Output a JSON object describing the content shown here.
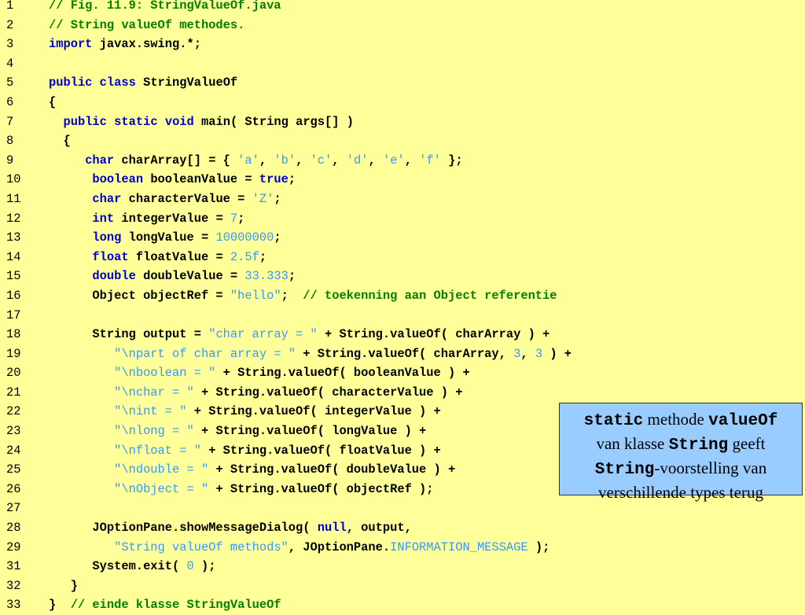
{
  "code_lines": [
    {
      "n": "1",
      "indent": "",
      "tokens": [
        {
          "t": "// Fig. 11.9: StringValueOf.java",
          "c": "cm"
        }
      ]
    },
    {
      "n": "2",
      "indent": "",
      "tokens": [
        {
          "t": "// String valueOf methodes.",
          "c": "cm"
        }
      ]
    },
    {
      "n": "3",
      "indent": "",
      "tokens": [
        {
          "t": "import",
          "c": "kw"
        },
        {
          "t": " javax.swing.*;",
          "c": "tx"
        }
      ]
    },
    {
      "n": "4",
      "indent": "",
      "tokens": []
    },
    {
      "n": "5",
      "indent": "",
      "tokens": [
        {
          "t": "public",
          "c": "kw"
        },
        {
          "t": " ",
          "c": "tx"
        },
        {
          "t": "class",
          "c": "kw"
        },
        {
          "t": " StringValueOf",
          "c": "tx"
        }
      ]
    },
    {
      "n": "6",
      "indent": "",
      "tokens": [
        {
          "t": "{",
          "c": "tx"
        }
      ]
    },
    {
      "n": "7",
      "indent": "  ",
      "tokens": [
        {
          "t": "public",
          "c": "kw"
        },
        {
          "t": " ",
          "c": "tx"
        },
        {
          "t": "static",
          "c": "kw"
        },
        {
          "t": " ",
          "c": "tx"
        },
        {
          "t": "void",
          "c": "kw"
        },
        {
          "t": " main( String args[] )",
          "c": "tx"
        }
      ]
    },
    {
      "n": "8",
      "indent": "  ",
      "tokens": [
        {
          "t": "{",
          "c": "tx"
        }
      ]
    },
    {
      "n": "9",
      "indent": "     ",
      "tokens": [
        {
          "t": "char",
          "c": "kw"
        },
        {
          "t": " charArray[] = { ",
          "c": "tx"
        },
        {
          "t": "'a'",
          "c": "lit"
        },
        {
          "t": ", ",
          "c": "tx"
        },
        {
          "t": "'b'",
          "c": "lit"
        },
        {
          "t": ", ",
          "c": "tx"
        },
        {
          "t": "'c'",
          "c": "lit"
        },
        {
          "t": ", ",
          "c": "tx"
        },
        {
          "t": "'d'",
          "c": "lit"
        },
        {
          "t": ", ",
          "c": "tx"
        },
        {
          "t": "'e'",
          "c": "lit"
        },
        {
          "t": ", ",
          "c": "tx"
        },
        {
          "t": "'f'",
          "c": "lit"
        },
        {
          "t": " };",
          "c": "tx"
        }
      ]
    },
    {
      "n": "10",
      "indent": "      ",
      "tokens": [
        {
          "t": "boolean",
          "c": "kw"
        },
        {
          "t": " booleanValue = ",
          "c": "tx"
        },
        {
          "t": "true",
          "c": "kw"
        },
        {
          "t": ";",
          "c": "tx"
        }
      ]
    },
    {
      "n": "11",
      "indent": "      ",
      "tokens": [
        {
          "t": "char",
          "c": "kw"
        },
        {
          "t": " characterValue = ",
          "c": "tx"
        },
        {
          "t": "'Z'",
          "c": "lit"
        },
        {
          "t": ";",
          "c": "tx"
        }
      ]
    },
    {
      "n": "12",
      "indent": "      ",
      "tokens": [
        {
          "t": "int",
          "c": "kw"
        },
        {
          "t": " integerValue = ",
          "c": "tx"
        },
        {
          "t": "7",
          "c": "lit"
        },
        {
          "t": ";",
          "c": "tx"
        }
      ]
    },
    {
      "n": "13",
      "indent": "      ",
      "tokens": [
        {
          "t": "long",
          "c": "kw"
        },
        {
          "t": " longValue = ",
          "c": "tx"
        },
        {
          "t": "10000000",
          "c": "lit"
        },
        {
          "t": ";",
          "c": "tx"
        }
      ]
    },
    {
      "n": "14",
      "indent": "      ",
      "tokens": [
        {
          "t": "float",
          "c": "kw"
        },
        {
          "t": " floatValue = ",
          "c": "tx"
        },
        {
          "t": "2.5f",
          "c": "lit"
        },
        {
          "t": ";",
          "c": "tx"
        }
      ]
    },
    {
      "n": "15",
      "indent": "      ",
      "tokens": [
        {
          "t": "double",
          "c": "kw"
        },
        {
          "t": " doubleValue = ",
          "c": "tx"
        },
        {
          "t": "33.333",
          "c": "lit"
        },
        {
          "t": ";",
          "c": "tx"
        }
      ]
    },
    {
      "n": "16",
      "indent": "      ",
      "tokens": [
        {
          "t": "Object objectRef = ",
          "c": "tx"
        },
        {
          "t": "\"hello\"",
          "c": "lit"
        },
        {
          "t": ";  ",
          "c": "tx"
        },
        {
          "t": "// toekenning aan Object referentie",
          "c": "cm"
        }
      ]
    },
    {
      "n": "17",
      "indent": "",
      "tokens": []
    },
    {
      "n": "18",
      "indent": "      ",
      "tokens": [
        {
          "t": "String output = ",
          "c": "tx"
        },
        {
          "t": "\"char array = \"",
          "c": "lit"
        },
        {
          "t": " + String.valueOf( charArray ) +",
          "c": "tx"
        }
      ]
    },
    {
      "n": "19",
      "indent": "         ",
      "tokens": [
        {
          "t": "\"\\npart of char array = \"",
          "c": "lit"
        },
        {
          "t": " + String.valueOf( charArray, ",
          "c": "tx"
        },
        {
          "t": "3",
          "c": "lit"
        },
        {
          "t": ", ",
          "c": "tx"
        },
        {
          "t": "3",
          "c": "lit"
        },
        {
          "t": " ) +",
          "c": "tx"
        }
      ]
    },
    {
      "n": "20",
      "indent": "         ",
      "tokens": [
        {
          "t": "\"\\nboolean = \"",
          "c": "lit"
        },
        {
          "t": " + String.valueOf( booleanValue ) +",
          "c": "tx"
        }
      ]
    },
    {
      "n": "21",
      "indent": "         ",
      "tokens": [
        {
          "t": "\"\\nchar = \"",
          "c": "lit"
        },
        {
          "t": " + String.valueOf( characterValue ) +",
          "c": "tx"
        }
      ]
    },
    {
      "n": "22",
      "indent": "         ",
      "tokens": [
        {
          "t": "\"\\nint = \"",
          "c": "lit"
        },
        {
          "t": " + String.valueOf( integerValue ) +",
          "c": "tx"
        }
      ]
    },
    {
      "n": "23",
      "indent": "         ",
      "tokens": [
        {
          "t": "\"\\nlong = \"",
          "c": "lit"
        },
        {
          "t": " + String.valueOf( longValue ) +",
          "c": "tx"
        }
      ]
    },
    {
      "n": "24",
      "indent": "         ",
      "tokens": [
        {
          "t": "\"\\nfloat = \"",
          "c": "lit"
        },
        {
          "t": " + String.valueOf( floatValue ) +",
          "c": "tx"
        }
      ]
    },
    {
      "n": "25",
      "indent": "         ",
      "tokens": [
        {
          "t": "\"\\ndouble = \"",
          "c": "lit"
        },
        {
          "t": " + String.valueOf( doubleValue ) +",
          "c": "tx"
        }
      ]
    },
    {
      "n": "26",
      "indent": "         ",
      "tokens": [
        {
          "t": "\"\\nObject = \"",
          "c": "lit"
        },
        {
          "t": " + String.valueOf( objectRef );",
          "c": "tx"
        }
      ]
    },
    {
      "n": "27",
      "indent": "",
      "tokens": []
    },
    {
      "n": "28",
      "indent": "      ",
      "tokens": [
        {
          "t": "JOptionPane.showMessageDialog( ",
          "c": "tx"
        },
        {
          "t": "null",
          "c": "kw"
        },
        {
          "t": ", output,",
          "c": "tx"
        }
      ]
    },
    {
      "n": "29",
      "indent": "         ",
      "tokens": [
        {
          "t": "\"String valueOf methods\"",
          "c": "lit"
        },
        {
          "t": ", JOptionPane.",
          "c": "tx"
        },
        {
          "t": "INFORMATION_MESSAGE",
          "c": "lit"
        },
        {
          "t": " );",
          "c": "tx"
        }
      ]
    },
    {
      "n": "31",
      "indent": "      ",
      "tokens": [
        {
          "t": "System.exit( ",
          "c": "tx"
        },
        {
          "t": "0",
          "c": "lit"
        },
        {
          "t": " );",
          "c": "tx"
        }
      ]
    },
    {
      "n": "32",
      "indent": "   ",
      "tokens": [
        {
          "t": "}",
          "c": "tx"
        }
      ]
    },
    {
      "n": "33",
      "indent": "",
      "tokens": [
        {
          "t": "}  ",
          "c": "tx"
        },
        {
          "t": "// einde klasse StringValueOf",
          "c": "cm"
        }
      ]
    }
  ],
  "callout": {
    "w1": "static",
    "w2": " methode ",
    "w3": "valueOf",
    "w4": "van klasse ",
    "w5": "String",
    "w6": " geeft",
    "w7": "String",
    "w8": "-voorstelling van",
    "w9": "verschillende types terug"
  },
  "colors": {
    "background": "#ffff99",
    "keyword": "#0000cc",
    "comment": "#008000",
    "literal": "#3399ff",
    "callout_bg": "#99ccff"
  }
}
